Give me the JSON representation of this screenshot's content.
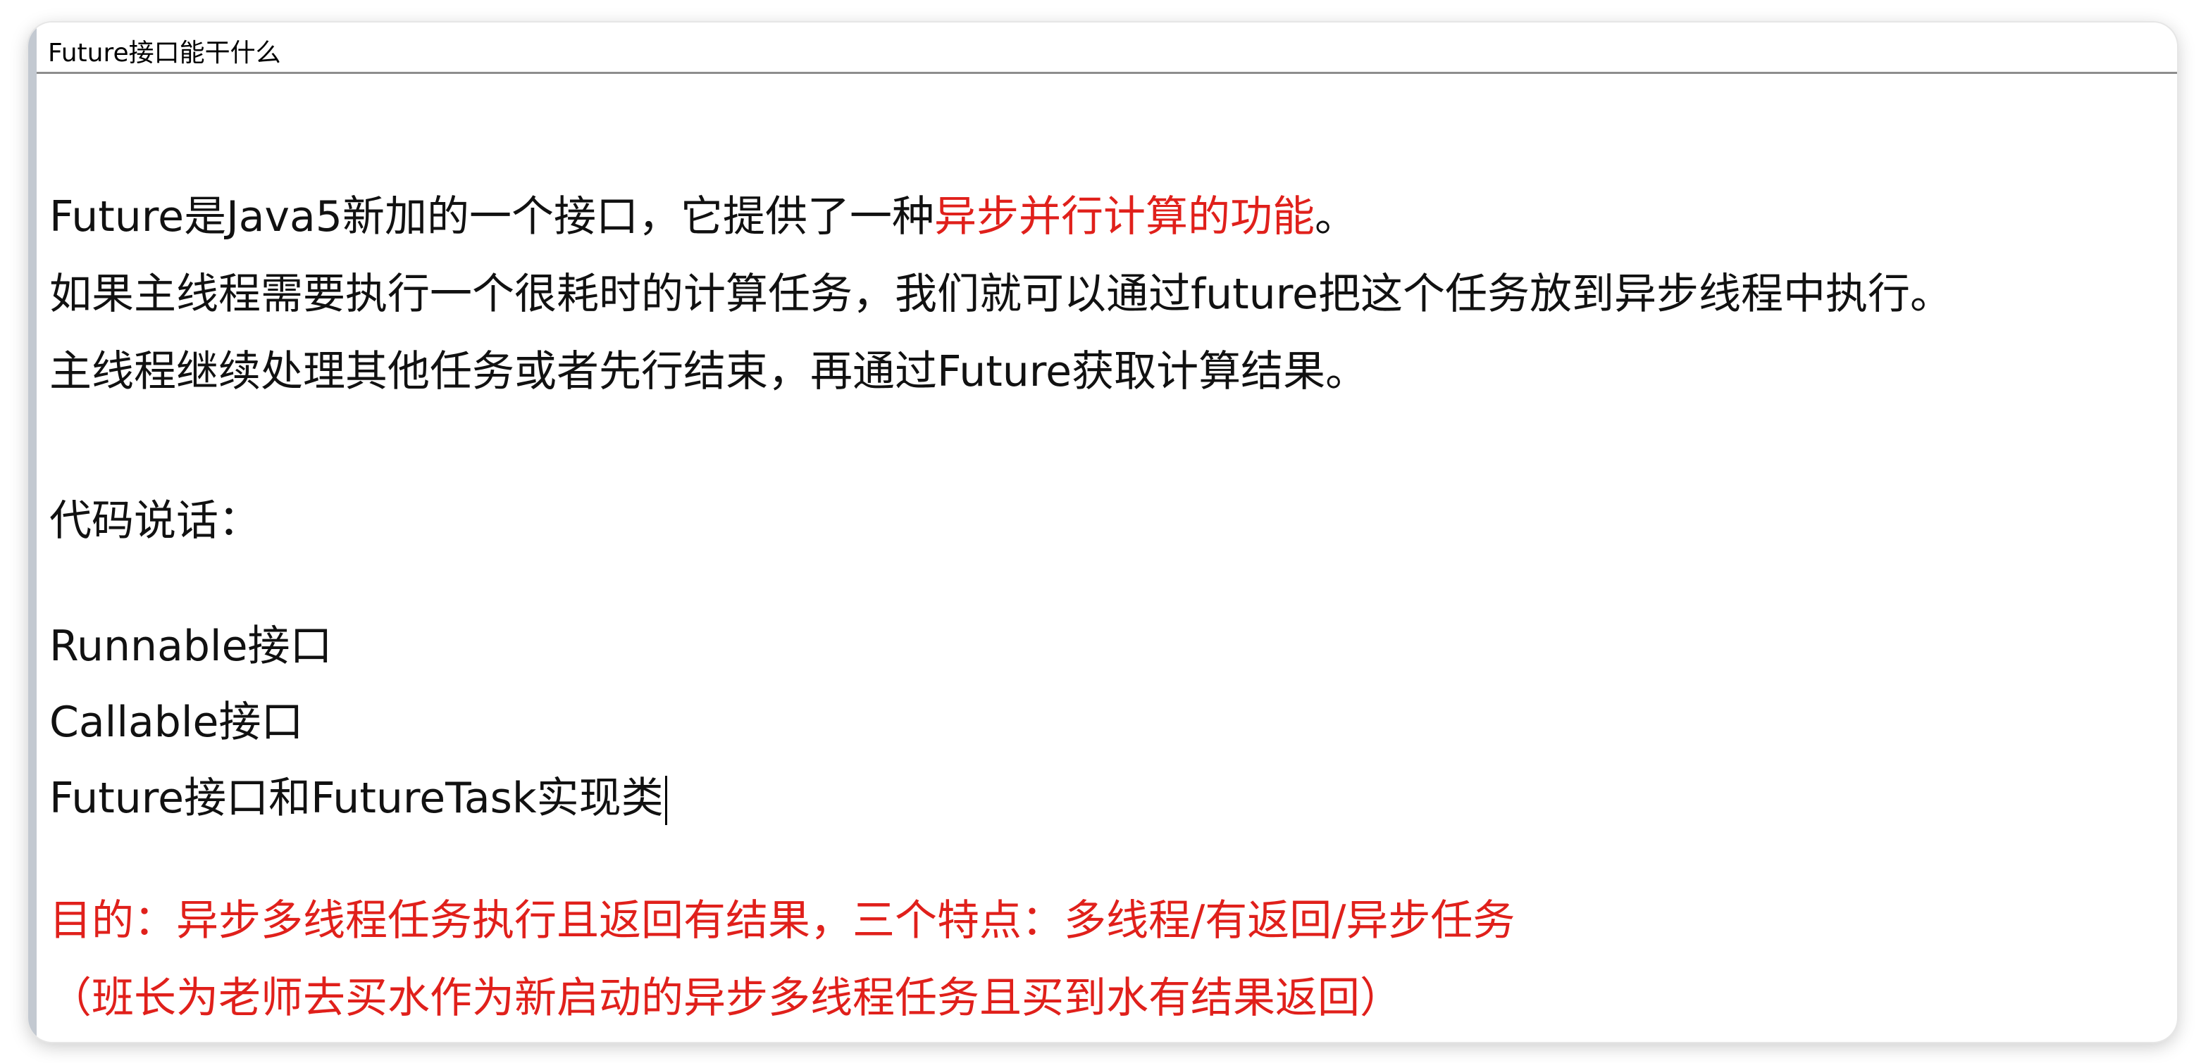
{
  "window": {
    "title": "Future接口能干什么"
  },
  "colors": {
    "text": "#111111",
    "accent_red": "#e0201b",
    "title_border": "#8d8d8d"
  },
  "body": {
    "intro_part1": "Future是Java5新加的一个接口，它提供了一种",
    "intro_highlight": "异步并行计算的功能",
    "intro_end": "。",
    "line2": "如果主线程需要执行一个很耗时的计算任务，我们就可以通过future把这个任务放到异步线程中执行。",
    "line3": "主线程继续处理其他任务或者先行结束，再通过Future获取计算结果。",
    "code_heading": "代码说话：",
    "item1": "Runnable接口",
    "item2": "Callable接口",
    "item3": "Future接口和FutureTask实现类",
    "purpose": "目的：异步多线程任务执行且返回有结果，三个特点：多线程/有返回/异步任务",
    "example": "（班长为老师去买水作为新启动的异步多线程任务且买到水有结果返回）"
  }
}
